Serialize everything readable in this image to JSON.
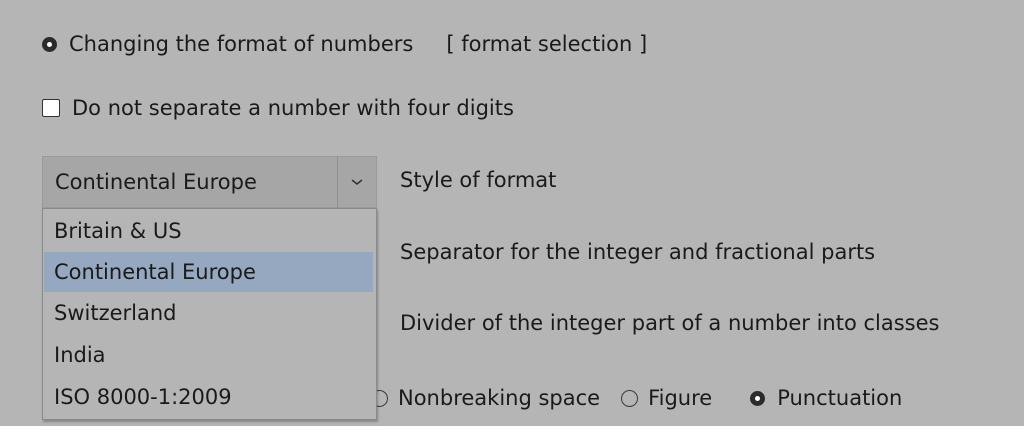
{
  "header_option": {
    "label": "Changing the format of numbers",
    "link": "[ format selection ]",
    "checked": true
  },
  "four_digits_option": {
    "label": "Do not separate a number with four digits",
    "checked": false
  },
  "style_select": {
    "selected_value": "Continental Europe",
    "label": "Style of format",
    "options": [
      "Britain & US",
      "Continental Europe",
      "Switzerland",
      "India",
      "ISO 8000-1:2009"
    ],
    "highlighted_option": "Continental Europe"
  },
  "separator_label": "Separator for the integer and fractional parts",
  "divider_label": "Divider of the integer part of a number into classes",
  "space_options": {
    "nonbreaking": "Nonbreaking space",
    "figure": "Figure",
    "punctuation": "Punctuation",
    "selected": "Punctuation"
  },
  "colors": {
    "background": "#b5b5b5",
    "highlight": "#96a8c0"
  }
}
